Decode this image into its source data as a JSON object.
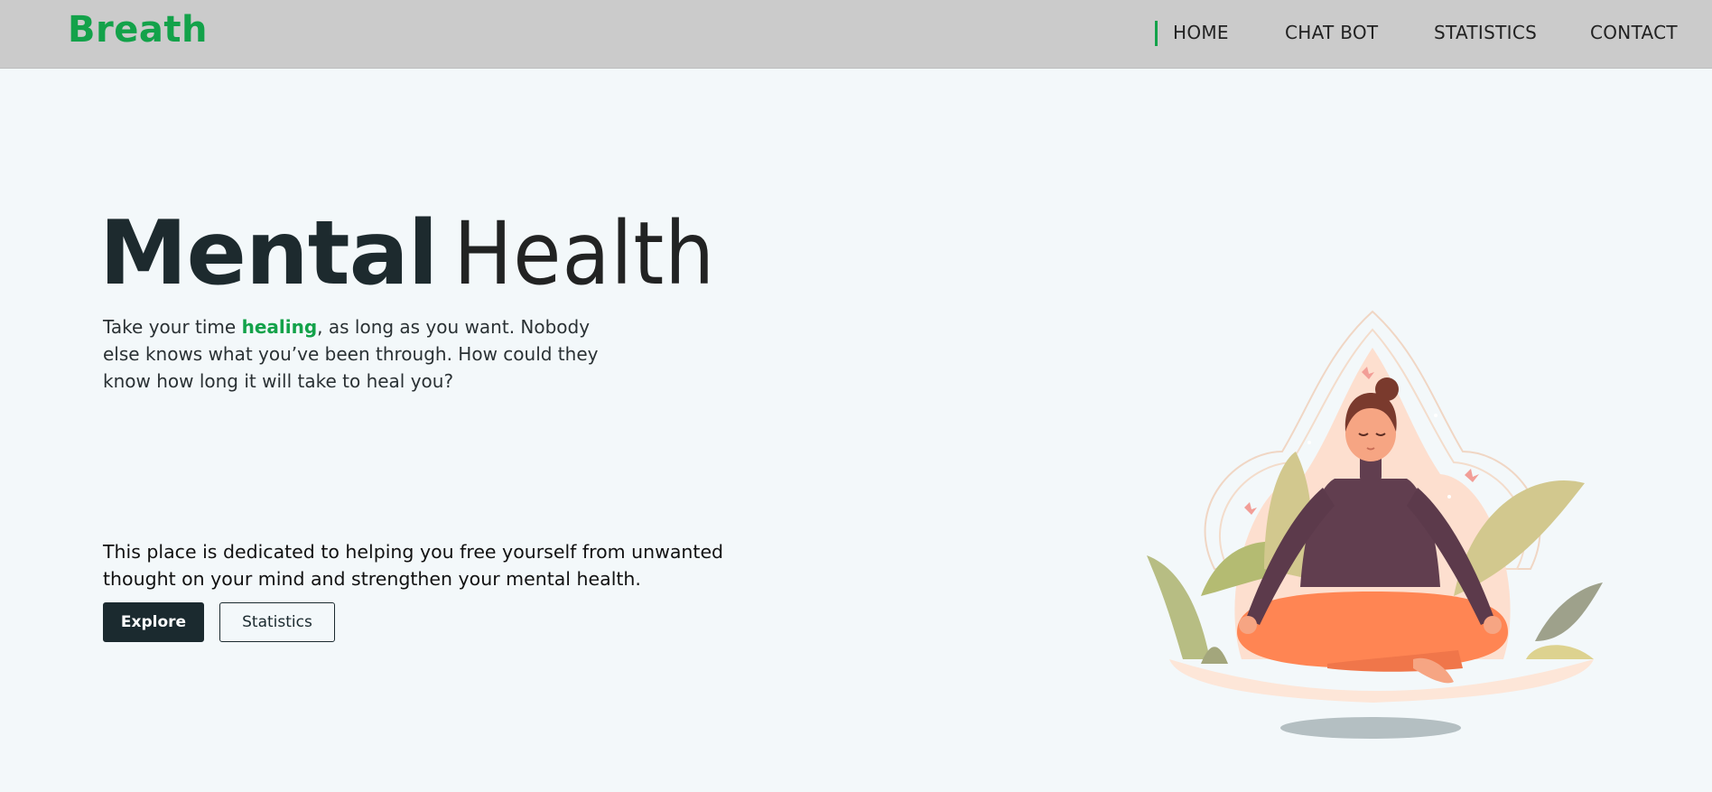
{
  "header": {
    "brand": "Breath",
    "nav": [
      {
        "label": "HOME",
        "active": true
      },
      {
        "label": "CHAT BOT",
        "active": false
      },
      {
        "label": "STATISTICS",
        "active": false
      },
      {
        "label": "CONTACT",
        "active": false
      }
    ]
  },
  "hero": {
    "title_bold": "Mental",
    "title_light": "Health",
    "tagline_before": "Take your time ",
    "tagline_accent": "healing",
    "tagline_after": ", as long as you want. Nobody else knows what you’ve been through. How could they know how long it will take to heal you?",
    "mission": "This place is dedicated to helping you free yourself from unwanted thought on your mind and strengthen your mental health.",
    "primary_button": "Explore",
    "secondary_button": "Statistics"
  },
  "illustration": {
    "subject": "meditating-woman-illustration"
  },
  "colors": {
    "accent": "#13a24a",
    "dark": "#1b2a2f",
    "header_bg": "#cbcbcb",
    "page_bg": "#f3f8fa"
  }
}
